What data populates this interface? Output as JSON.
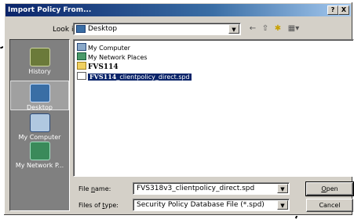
{
  "dialog": {
    "title": "Import Policy From...",
    "help_glyph": "?",
    "close_glyph": "X"
  },
  "lookin": {
    "label": "Look in:",
    "value": "Desktop",
    "arrow": "▼"
  },
  "toolbar": {
    "back": "←",
    "up": "⇧",
    "new_folder": "✱",
    "views": "▦▾"
  },
  "places": [
    {
      "label": "History"
    },
    {
      "label": "Desktop"
    },
    {
      "label": "My Computer"
    },
    {
      "label": "My Network P..."
    }
  ],
  "files": [
    {
      "name": "My Computer"
    },
    {
      "name": "My Network Places"
    },
    {
      "name": "FVS114"
    },
    {
      "prefix": "FVS114",
      "suffix": "_clientpolicy_direct.spd"
    }
  ],
  "filename": {
    "label_pre": "File ",
    "label_u": "n",
    "label_post": "ame:",
    "value": "FVS318v3_clientpolicy_direct.spd",
    "arrow": "▼"
  },
  "filetype": {
    "label_pre": "Files of ",
    "label_u": "t",
    "label_post": "ype:",
    "value": "Security Policy Database File (*.spd)",
    "arrow": "▼"
  },
  "buttons": {
    "open_u": "O",
    "open_rest": "pen",
    "cancel": "Cancel"
  }
}
